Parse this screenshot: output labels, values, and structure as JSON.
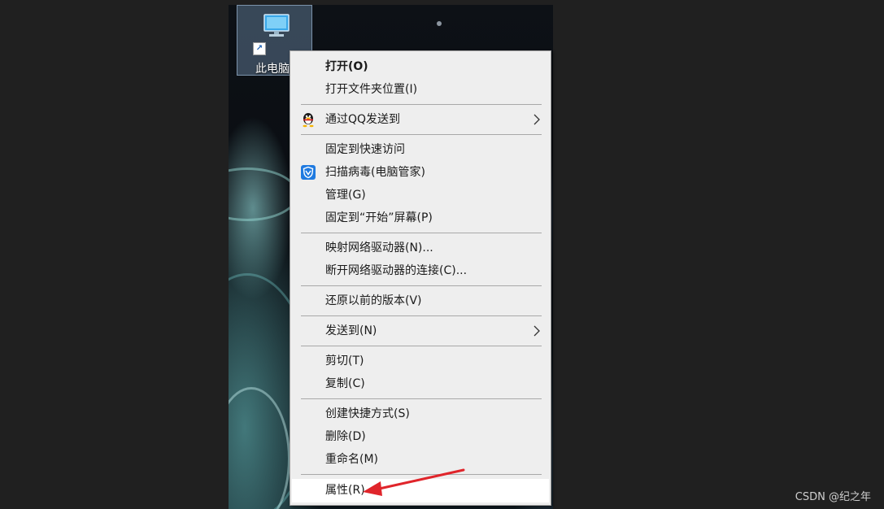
{
  "desktop": {
    "icon_label": "此电脑",
    "icon_name": "this-pc-icon"
  },
  "menu": {
    "open": "打开(O)",
    "open_location": "打开文件夹位置(I)",
    "send_via_qq": "通过QQ发送到",
    "pin_quick_access": "固定到快速访问",
    "scan_virus": "扫描病毒(电脑管家)",
    "manage": "管理(G)",
    "pin_start": "固定到“开始”屏幕(P)",
    "map_drive": "映射网络驱动器(N)...",
    "disconnect_drive": "断开网络驱动器的连接(C)...",
    "restore_versions": "还原以前的版本(V)",
    "send_to": "发送到(N)",
    "cut": "剪切(T)",
    "copy": "复制(C)",
    "create_shortcut": "创建快捷方式(S)",
    "delete": "删除(D)",
    "rename": "重命名(M)",
    "properties": "属性(R)"
  },
  "annotation": {
    "arrow_color": "#e0252b"
  },
  "watermark": "CSDN @纪之年"
}
